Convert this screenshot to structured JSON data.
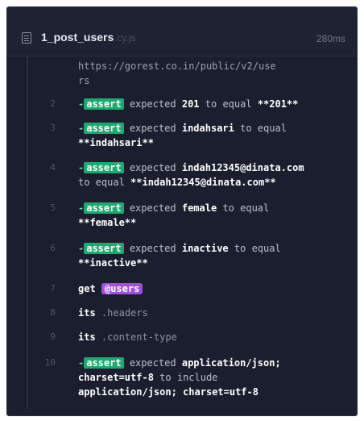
{
  "header": {
    "spec_name": "1_post_users",
    "spec_ext": ".cy.js",
    "duration": "280ms"
  },
  "url_line": {
    "part1": "https://gorest.co.in/public/v2/use",
    "part2": "rs"
  },
  "commands": [
    {
      "num": "2",
      "dash": "-",
      "badge": "assert",
      "w1": "expected",
      "v1": "201",
      "w2": "to equal",
      "v2": "**201**"
    },
    {
      "num": "3",
      "dash": "-",
      "badge": "assert",
      "w1": "expected",
      "v1": "indahsari",
      "w2": "to equal",
      "v2": "**indahsari**"
    },
    {
      "num": "4",
      "dash": "-",
      "badge": "assert",
      "w1": "expected",
      "v1": "indah12345@dinata.com",
      "w2": "to equal",
      "v2": "**indah12345@dinata.com**"
    },
    {
      "num": "5",
      "dash": "-",
      "badge": "assert",
      "w1": "expected",
      "v1": "female",
      "w2": "to equal",
      "v2": "**female**"
    },
    {
      "num": "6",
      "dash": "-",
      "badge": "assert",
      "w1": "expected",
      "v1": "inactive",
      "w2": "to equal",
      "v2": "**inactive**"
    },
    {
      "num": "7",
      "cmd": "get",
      "alias": "@users"
    },
    {
      "num": "8",
      "cmd": "its",
      "arg": ".headers"
    },
    {
      "num": "9",
      "cmd": "its",
      "arg": ".content-type"
    },
    {
      "num": "10",
      "dash": "-",
      "badge": "assert",
      "w1": "expected",
      "v1": "application/json;",
      "v1b": "charset=utf-8",
      "w2": "to include",
      "v2": "application/json; charset=utf-8"
    }
  ],
  "colors": {
    "panel_bg": "#1b1e2e",
    "assert_badge": "#1fa971",
    "alias_badge": "#a050e0"
  }
}
